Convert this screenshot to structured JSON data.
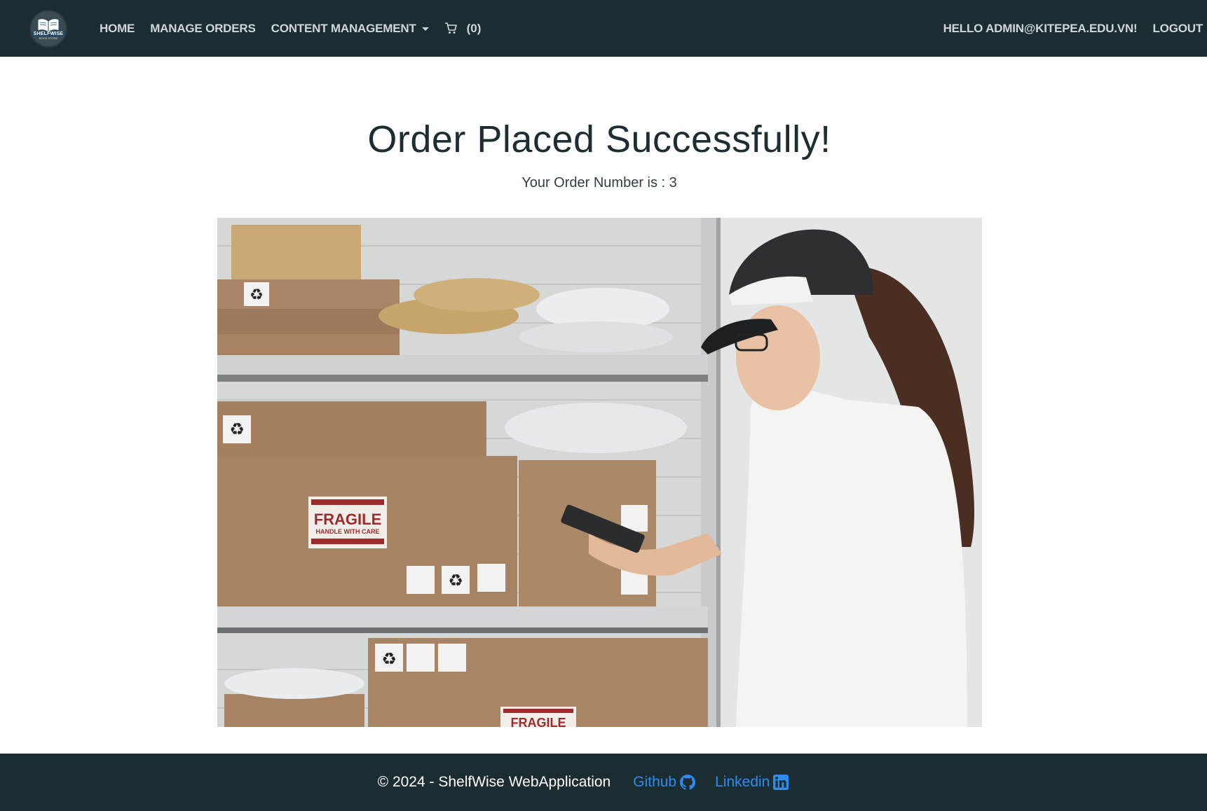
{
  "logo": {
    "text": "SHELFWISE",
    "sub": "BOOK STORE"
  },
  "nav": {
    "home": "HOME",
    "manage_orders": "MANAGE ORDERS",
    "content_management": "CONTENT MANAGEMENT",
    "cart_count": "(0)",
    "greeting": "HELLO ADMIN@KITEPEA.EDU.VN!",
    "logout": "LOGOUT"
  },
  "main": {
    "title": "Order Placed Successfully!",
    "order_number": "Your Order Number is : 3"
  },
  "photo": {
    "box_label_1": "FRAGILE",
    "box_label_2": "HANDLE WITH CARE",
    "box_label_3": "FRAGILE"
  },
  "footer": {
    "copyright": "© 2024 - ShelfWise WebApplication",
    "github": "Github",
    "linkedin": "Linkedin"
  },
  "colors": {
    "navbar_bg": "#1c2d31",
    "link_blue": "#2e8bf0",
    "title_text": "#1c2e32"
  }
}
